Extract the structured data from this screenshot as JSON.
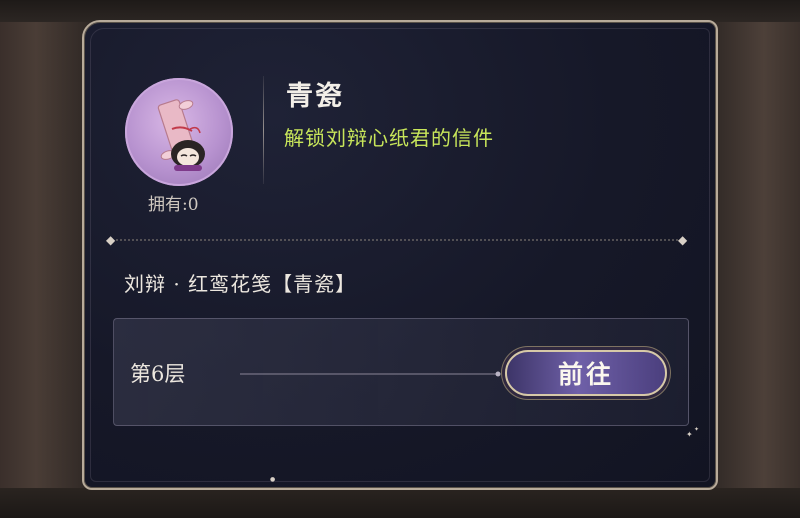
{
  "item": {
    "name": "青瓷",
    "description": "解锁刘辩心纸君的信件",
    "owned_label": "拥有:0",
    "icon": "scroll-letter-icon"
  },
  "source": {
    "title": "刘辩 · 红鸾花笺【青瓷】",
    "floor_label": "第6层",
    "go_button_label": "前往"
  },
  "colors": {
    "panel_bg": "#161828",
    "description_green": "#c8e65a",
    "button_purple": "#6f60a8",
    "border_gold": "#b8ab9a"
  }
}
